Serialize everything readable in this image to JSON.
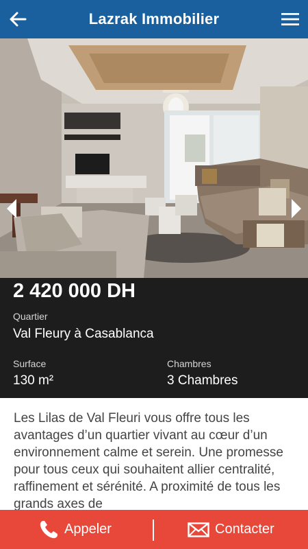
{
  "appbar": {
    "title": "Lazrak Immobilier",
    "back_icon": "arrow-left-icon",
    "menu_icon": "hamburger-menu-icon"
  },
  "gallery": {
    "image": "living-room-photo",
    "prev_icon": "chevron-left-icon",
    "next_icon": "chevron-right-icon"
  },
  "listing": {
    "price": "2 420 000 DH",
    "quartier_label": "Quartier",
    "quartier_value": "Val Fleury à Casablanca",
    "surface_label": "Surface",
    "surface_value": "130 m²",
    "chambres_label": "Chambres",
    "chambres_value": "3 Chambres"
  },
  "description": "Les Lilas de Val Fleuri vous offre tous les avantages d’un quartier vivant au cœur d’un environnement calme et serein. Une promesse pour tous ceux qui souhaitent allier centralité, raffinement et sérénité. A proximité de tous les grands axes de",
  "actions": {
    "call_label": "Appeler",
    "call_icon": "phone-icon",
    "contact_label": "Contacter",
    "contact_icon": "envelope-icon"
  },
  "colors": {
    "appbar": "#1a5f9e",
    "info_panel": "#1d1d1d",
    "bottom_bar": "#e8483a"
  }
}
